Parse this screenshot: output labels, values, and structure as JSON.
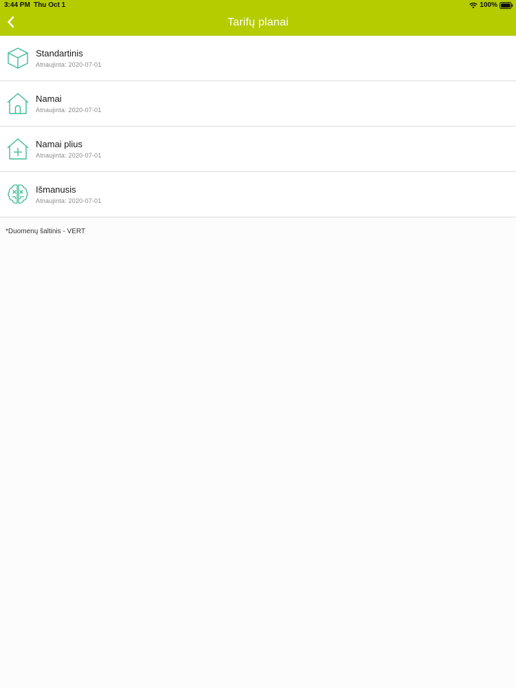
{
  "status_bar": {
    "time": "3:44 PM",
    "date": "Thu Oct 1",
    "battery": "100%"
  },
  "nav": {
    "title": "Tarifų planai",
    "back_icon": "chevron-left-icon"
  },
  "plans": [
    {
      "title": "Standartinis",
      "updated": "Atnaujinta: 2020-07-01",
      "icon": "box-icon"
    },
    {
      "title": "Namai",
      "updated": "Atnaujinta: 2020-07-01",
      "icon": "house-icon"
    },
    {
      "title": "Namai plius",
      "updated": "Atnaujinta: 2020-07-01",
      "icon": "house-plus-icon"
    },
    {
      "title": "Išmanusis",
      "updated": "Atnaujinta: 2020-07-01",
      "icon": "brain-icon"
    }
  ],
  "footnote": "*Duomenų šaltinis - VERT",
  "colors": {
    "accent": "#b5cc00",
    "icon": "#3fb89a",
    "background": "#fcfcfc"
  }
}
